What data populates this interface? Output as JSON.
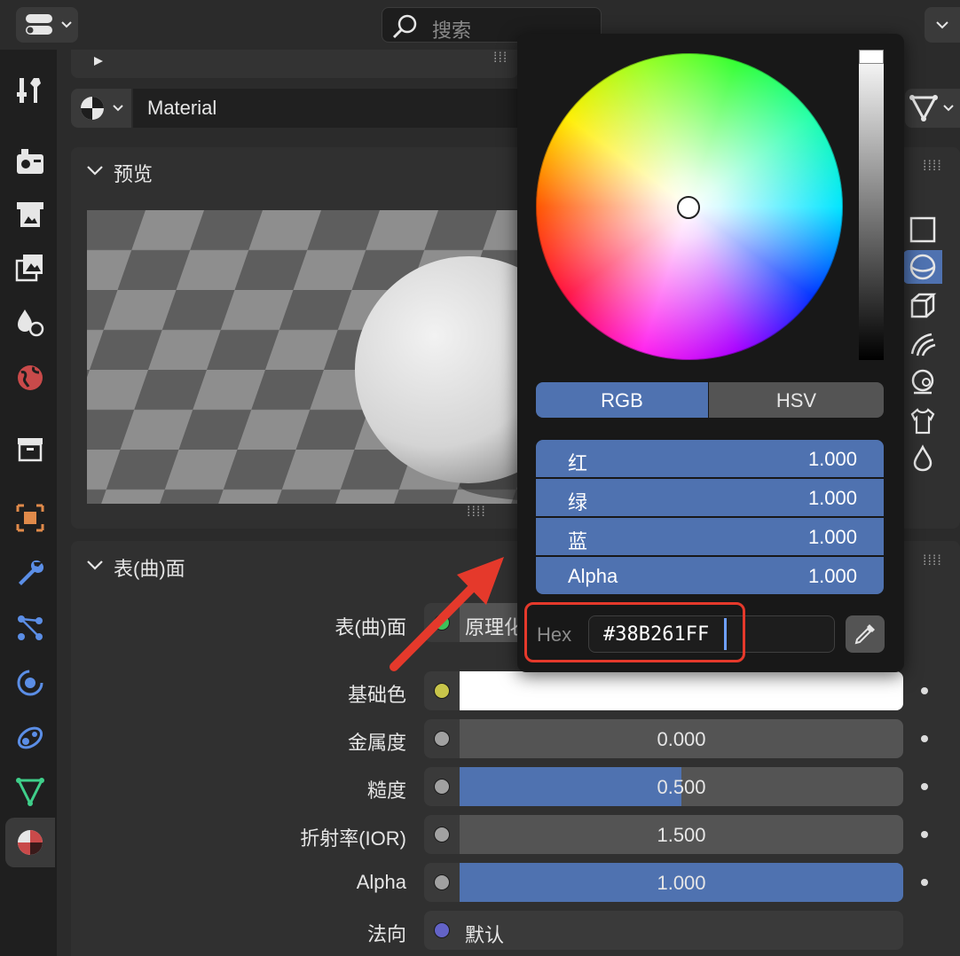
{
  "header": {
    "search_placeholder": "搜索"
  },
  "material": {
    "name": "Material"
  },
  "preview_panel": {
    "title": "预览"
  },
  "surface_panel": {
    "title": "表(曲)面",
    "surface_label": "表(曲)面",
    "surface_value": "原理化",
    "rows": [
      {
        "label": "基础色",
        "value": "",
        "socket_color": "#c8c54a"
      },
      {
        "label": "金属度",
        "value": "0.000",
        "socket_color": "#a1a1a1",
        "fill": 0.0
      },
      {
        "label": "糙度",
        "value": "0.500",
        "socket_color": "#a1a1a1",
        "fill": 0.5
      },
      {
        "label": "折射率(IOR)",
        "value": "1.500",
        "socket_color": "#a1a1a1",
        "fill": 0.0
      },
      {
        "label": "Alpha",
        "value": "1.000",
        "socket_color": "#a1a1a1",
        "fill": 1.0
      },
      {
        "label": "法向",
        "value": "默认",
        "socket_color": "#6363c7"
      }
    ]
  },
  "color_picker": {
    "modes": [
      "RGB",
      "HSV"
    ],
    "active_mode": "RGB",
    "channels": [
      {
        "label": "红",
        "value": "1.000"
      },
      {
        "label": "绿",
        "value": "1.000"
      },
      {
        "label": "蓝",
        "value": "1.000"
      },
      {
        "label": "Alpha",
        "value": "1.000"
      }
    ],
    "hex_label": "Hex",
    "hex_value": "#38B261FF"
  },
  "colors": {
    "accent": "#4f72b0",
    "highlight": "#e5392b",
    "base_color": "#ffffff"
  }
}
